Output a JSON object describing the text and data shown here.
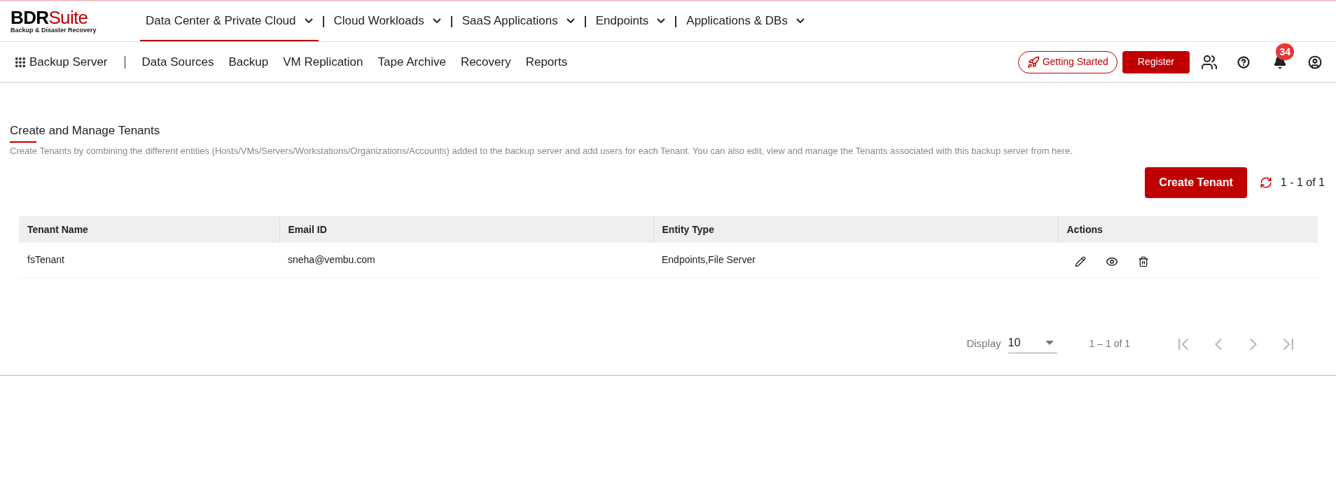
{
  "logo": {
    "brand_dark": "BDR",
    "brand_red": "Suite",
    "tagline": "Backup & Disaster Recovery"
  },
  "top_nav": [
    {
      "label": "Data Center & Private Cloud",
      "selected": true
    },
    {
      "label": "Cloud Workloads",
      "selected": false
    },
    {
      "label": "SaaS Applications",
      "selected": false
    },
    {
      "label": "Endpoints",
      "selected": false
    },
    {
      "label": "Applications & DBs",
      "selected": false
    }
  ],
  "sub_nav": {
    "title": "Backup Server",
    "items": [
      "Data Sources",
      "Backup",
      "VM Replication",
      "Tape Archive",
      "Recovery",
      "Reports"
    ]
  },
  "header_actions": {
    "getting_started": "Getting Started",
    "register": "Register",
    "notification_count": "34"
  },
  "page": {
    "title": "Create and Manage Tenants",
    "description": "Create Tenants by combining the different entities (Hosts/VMs/Servers/Workstations/Organizations/Accounts) added to the backup server and add users for each Tenant. You can also edit, view and manage the Tenants associated with this backup server from here.",
    "create_button": "Create Tenant",
    "count": "1 - 1 of 1"
  },
  "table": {
    "columns": [
      "Tenant Name",
      "Email ID",
      "Entity Type",
      "Actions"
    ],
    "rows": [
      {
        "cells": [
          "fsTenant",
          "sneha@vembu.com",
          "Endpoints,File Server"
        ]
      }
    ]
  },
  "pagination": {
    "display_label": "Display",
    "page_size": "10",
    "range": "1 – 1 of 1",
    "buttons": [
      {
        "kind": "first",
        "disabled": true
      },
      {
        "kind": "prev",
        "disabled": true
      },
      {
        "kind": "next",
        "disabled": true
      },
      {
        "kind": "last",
        "disabled": true
      }
    ]
  }
}
